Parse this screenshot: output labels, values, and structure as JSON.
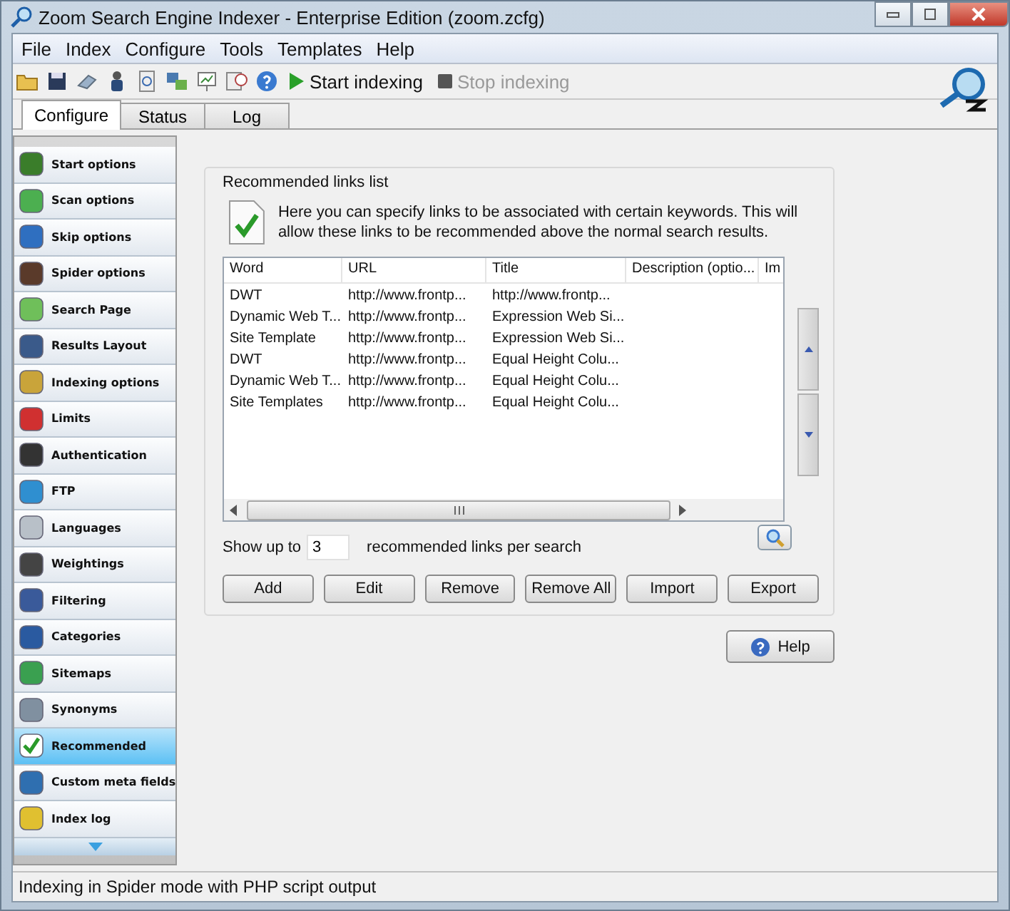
{
  "window": {
    "title": "Zoom Search Engine Indexer - Enterprise Edition (zoom.zcfg)"
  },
  "menu": [
    "File",
    "Index",
    "Configure",
    "Tools",
    "Templates",
    "Help"
  ],
  "toolbar": [
    {
      "label": "Start indexing",
      "disabled": false
    },
    {
      "label": "Stop indexing",
      "disabled": true
    }
  ],
  "tabs": [
    {
      "label": "Configure",
      "selected": true
    },
    {
      "label": "Status",
      "selected": false
    },
    {
      "label": "Log",
      "selected": false
    }
  ],
  "sidebar": {
    "items": [
      {
        "label": "Start options",
        "selected": false
      },
      {
        "label": "Scan options",
        "selected": false
      },
      {
        "label": "Skip options",
        "selected": false
      },
      {
        "label": "Spider options",
        "selected": false
      },
      {
        "label": "Search Page",
        "selected": false
      },
      {
        "label": "Results Layout",
        "selected": false
      },
      {
        "label": "Indexing options",
        "selected": false
      },
      {
        "label": "Limits",
        "selected": false
      },
      {
        "label": "Authentication",
        "selected": false
      },
      {
        "label": "FTP",
        "selected": false
      },
      {
        "label": "Languages",
        "selected": false
      },
      {
        "label": "Weightings",
        "selected": false
      },
      {
        "label": "Filtering",
        "selected": false
      },
      {
        "label": "Categories",
        "selected": false
      },
      {
        "label": "Sitemaps",
        "selected": false
      },
      {
        "label": "Synonyms",
        "selected": false
      },
      {
        "label": "Recommended",
        "selected": true
      },
      {
        "label": "Custom meta fields",
        "selected": false
      },
      {
        "label": "Index log",
        "selected": false
      }
    ]
  },
  "group": {
    "title": "Recommended links list",
    "description": "Here you can specify links to be associated with certain keywords. This will allow these links to be recommended above the normal search results."
  },
  "table": {
    "columns": [
      "Word",
      "URL",
      "Title",
      "Description (optio...",
      "Im"
    ],
    "rows": [
      [
        "DWT",
        "http://www.frontp...",
        "http://www.frontp..."
      ],
      [
        "Dynamic Web T...",
        "http://www.frontp...",
        "Expression Web Si..."
      ],
      [
        "Site Template",
        "http://www.frontp...",
        "Expression Web Si..."
      ],
      [
        "DWT",
        "http://www.frontp...",
        "Equal Height Colu..."
      ],
      [
        "Dynamic Web T...",
        "http://www.frontp...",
        "Equal Height Colu..."
      ],
      [
        "Site Templates",
        "http://www.frontp...",
        "Equal Height Colu..."
      ]
    ]
  },
  "limit": {
    "before": "Show up to",
    "value": "3",
    "after": "recommended links per search"
  },
  "buttons": [
    "Add",
    "Edit",
    "Remove",
    "Remove All",
    "Import",
    "Export"
  ],
  "help_button": "Help",
  "status_bar": "Indexing in Spider mode with PHP script output"
}
